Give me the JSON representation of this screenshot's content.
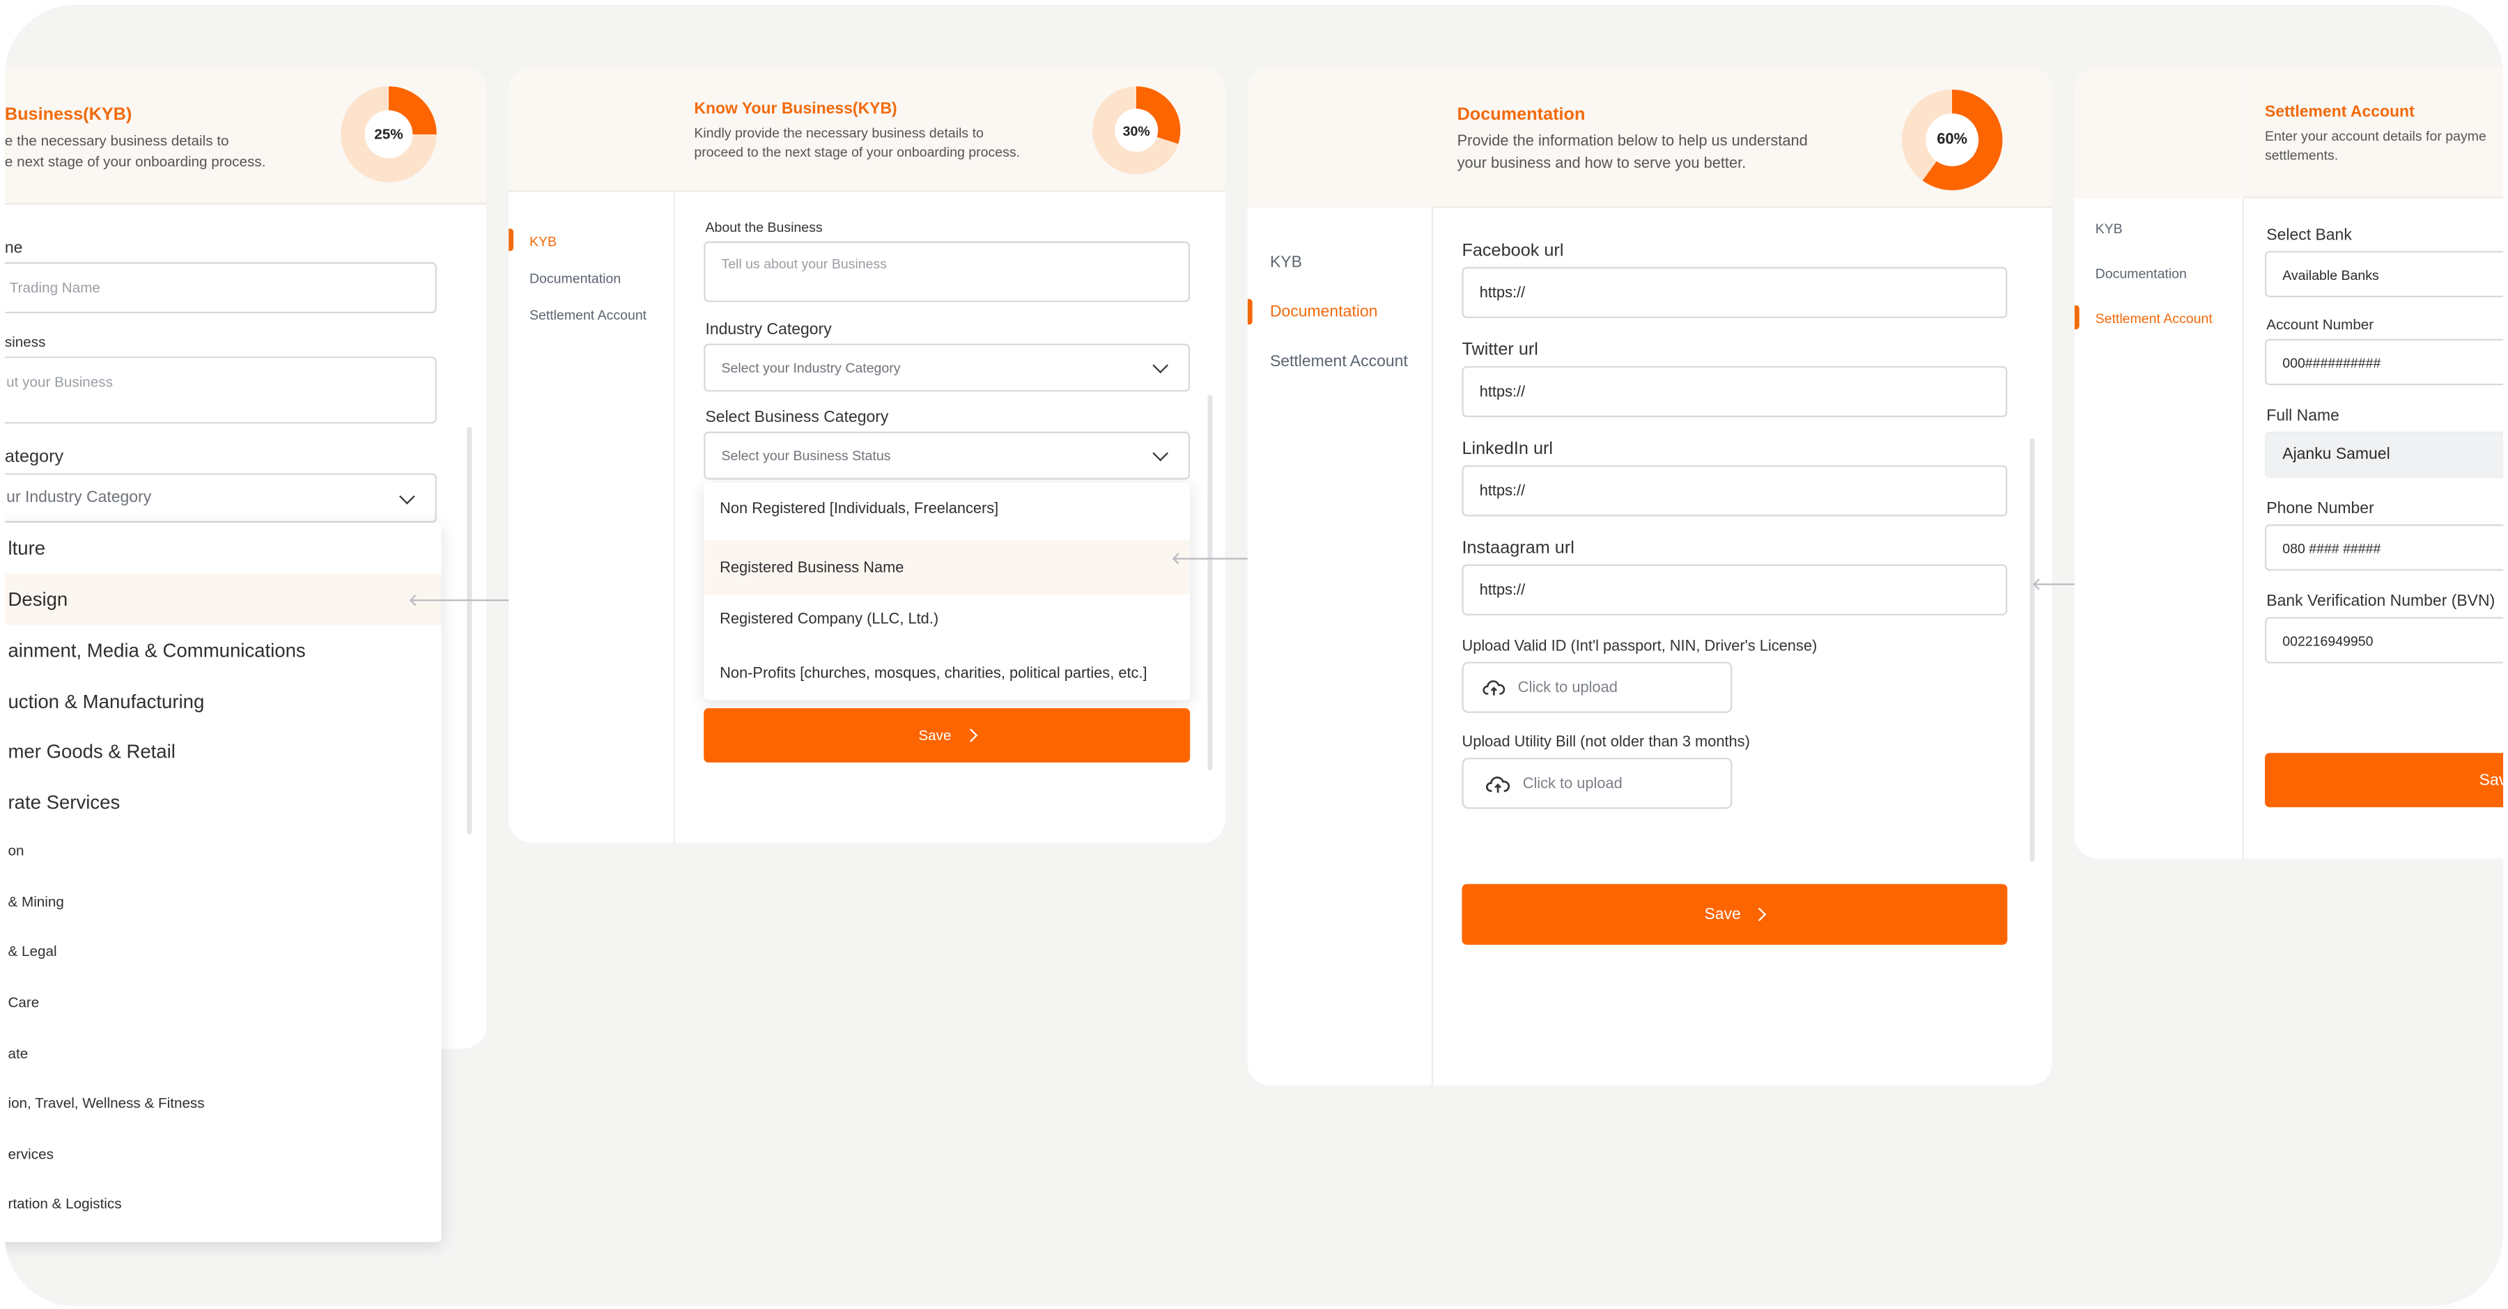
{
  "colors": {
    "accent": "#fd6500",
    "donut_track": "#fde3cc",
    "board": "#f4f4f3"
  },
  "panel1": {
    "title": "Business(KYB)",
    "desc_line1": "e the necessary business details to",
    "desc_line2": "e next stage of your onboarding process.",
    "progress_label": "25%",
    "progress_percent": 25,
    "name_label": "ne",
    "name_placeholder": "Trading Name",
    "business_label": "siness",
    "business_placeholder": "ut your Business",
    "category_label": "ategory",
    "category_placeholder": "ur Industry Category",
    "options": [
      "lture",
      " Design",
      "ainment, Media & Communications",
      "uction & Manufacturing",
      "mer Goods & Retail",
      "rate Services",
      "on",
      "& Mining",
      "& Legal",
      "Care",
      "ate",
      "ion, Travel, Wellness & Fitness",
      "ervices",
      "rtation & Logistics"
    ]
  },
  "panel2": {
    "title": "Know Your Business(KYB)",
    "desc_line1": "Kindly provide the necessary business details to",
    "desc_line2": "proceed to the next stage of your onboarding process.",
    "progress_label": "30%",
    "progress_percent": 30,
    "nav": [
      "KYB",
      "Documentation",
      "Settlement Account"
    ],
    "about_label": "About the Business",
    "about_placeholder": "Tell us about your Business",
    "industry_label": "Industry Category",
    "industry_placeholder": "Select your Industry Category",
    "bizcat_label": "Select Business Category",
    "bizcat_placeholder": "Select your Business Status",
    "options": [
      "Non Registered [Individuals, Freelancers]",
      "Registered Business Name",
      "Registered Company (LLC, Ltd.)",
      "Non-Profits [churches, mosques, charities, political parties, etc.]"
    ],
    "save": "Save"
  },
  "panel3": {
    "title": "Documentation",
    "desc_line1": "Provide the information below to help us understand",
    "desc_line2": "your business and how to serve you better.",
    "progress_label": "60%",
    "progress_percent": 60,
    "nav": [
      "KYB",
      "Documentation",
      "Settlement Account"
    ],
    "facebook_label": "Facebook url",
    "facebook_value": "https://",
    "twitter_label": "Twitter url",
    "twitter_value": "https://",
    "linkedin_label": "LinkedIn url",
    "linkedin_value": "https://",
    "instagram_label": "Instaagram url",
    "instagram_value": "https://",
    "upload_id_label": "Upload Valid ID (Int'l passport, NIN, Driver's License)",
    "upload_id_text": "Click to upload",
    "upload_bill_label": "Upload Utility Bill (not older than 3 months)",
    "upload_bill_text": "Click to upload",
    "save": "Save"
  },
  "panel4": {
    "title": "Settlement Account",
    "desc_line1": "Enter your account details for payme",
    "desc_line2": "settlements.",
    "nav": [
      "KYB",
      "Documentation",
      "Settlement Account"
    ],
    "bank_label": "Select Bank",
    "bank_value": "Available Banks",
    "account_label": "Account Number",
    "account_value": "000##########",
    "fullname_label": "Full Name",
    "fullname_value": "Ajanku Samuel",
    "phone_label": "Phone Number",
    "phone_value": "080 #### #####",
    "bvn_label": "Bank Verification Number (BVN)",
    "bvn_value": "002216949950",
    "save": "Sav"
  }
}
